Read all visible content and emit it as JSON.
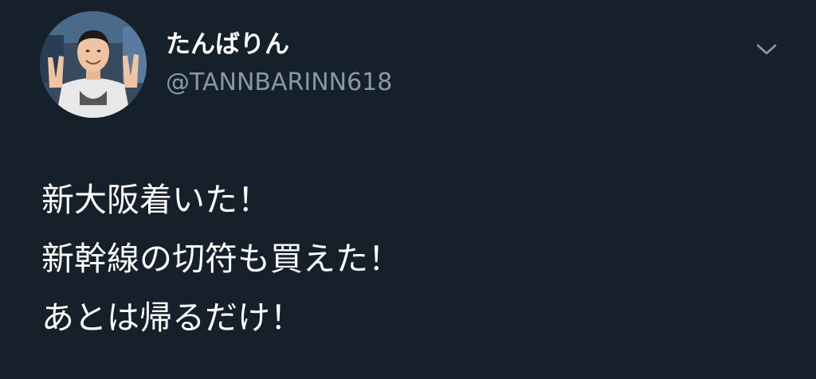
{
  "tweet": {
    "author": {
      "display_name": "たんばりん",
      "handle": "@TANNBARINN618",
      "avatar_icon": "profile-photo"
    },
    "menu_icon": "chevron-down-icon",
    "text_lines": [
      "新大阪着いた！",
      "新幹線の切符も買えた！",
      "あとは帰るだけ！"
    ]
  },
  "colors": {
    "background": "#15202b",
    "text_primary": "#ffffff",
    "text_secondary": "#8899a6"
  }
}
